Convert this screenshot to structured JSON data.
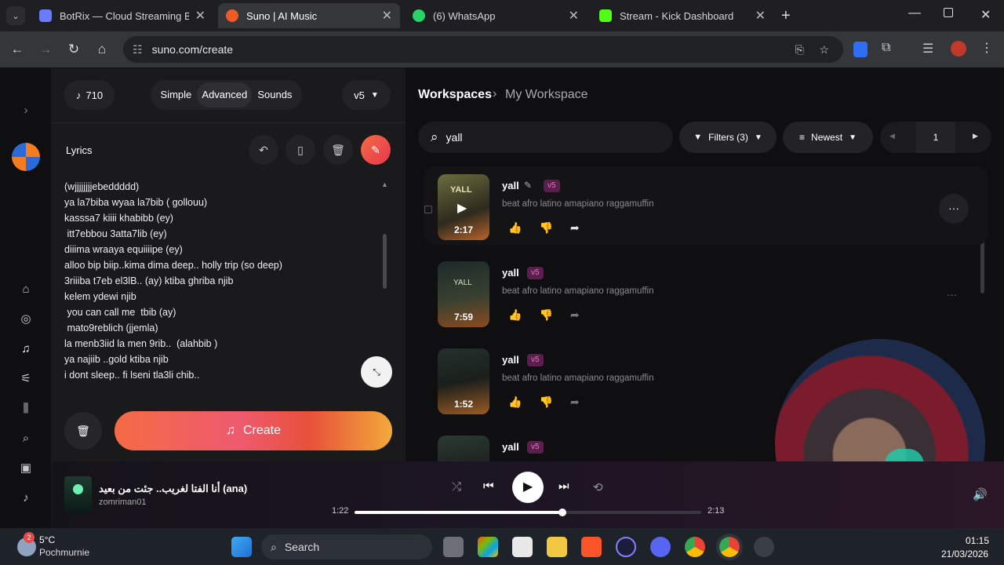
{
  "browser": {
    "tabs": [
      {
        "title": "BotRix — Cloud Streaming Bot",
        "color": "#6a7bff"
      },
      {
        "title": "Suno | AI Music",
        "color": "#f05a28"
      },
      {
        "title": "(6) WhatsApp",
        "color": "#25d366"
      },
      {
        "title": "Stream - Kick Dashboard",
        "color": "#53fc18"
      }
    ],
    "url": "suno.com/create"
  },
  "left": {
    "credits": "710",
    "modes": [
      "Simple",
      "Advanced",
      "Sounds"
    ],
    "model": "v5",
    "lyrics_label": "Lyrics",
    "lyrics": "(wjjjjjjjjebeddddd)\nya la7biba wyaa la7bib ( gollouu)\nkasssa7 kiiii khabibb (ey)\n itt7ebbou 3atta7lib (ey)\ndiiima wraaya equiiiipe (ey)\nalloo bip biip..kima dima deep.. holly trip (so deep)\n3riiiba t7eb el3lB.. (ay) ktiba ghriba njib\nkelem ydewi njib\n you can call me  tbib (ay)\n mato9reblich (jjemla)\nla menb3iid la men 9rib..  (alahbib )\nya najiib ..gold ktiba njib\ni dont sleep.. fi lseni tla3li chib..",
    "create_label": "Create"
  },
  "right": {
    "breadcrumb_root": "Workspaces",
    "breadcrumb_current": "My Workspace",
    "search_value": "yall",
    "filters_label": "Filters (3)",
    "sort_label": "Newest",
    "page": "1",
    "songs": [
      {
        "title": "yall",
        "tag": "v5",
        "desc": "beat afro latino amapiano raggamuffin",
        "duration": "2:17"
      },
      {
        "title": "yall",
        "tag": "v5",
        "desc": "beat afro latino amapiano raggamuffin",
        "duration": "7:59"
      },
      {
        "title": "yall",
        "tag": "v5",
        "desc": "beat afro latino amapiano raggamuffin",
        "duration": "1:52"
      },
      {
        "title": "yall",
        "tag": "v5",
        "desc": "",
        "duration": ""
      }
    ]
  },
  "player": {
    "title": "أنا الفتا لغريب.. جئت من بعيد (ana)",
    "artist": "zomriman01",
    "elapsed": "1:22",
    "total": "2:13",
    "progress": 0.6
  },
  "taskbar": {
    "weather_temp": "5°C",
    "weather_place": "Pochmurnie",
    "weather_badge": "2",
    "search": "Search",
    "time": "01:15",
    "date": "21/03/2026"
  }
}
